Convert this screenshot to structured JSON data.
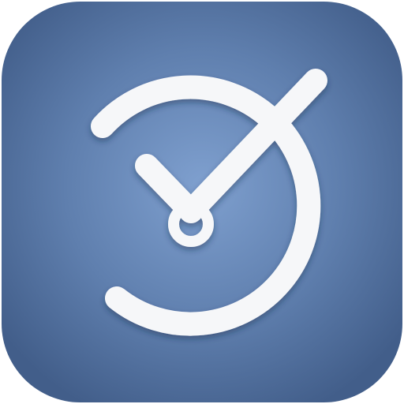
{
  "app_icon": {
    "kind": "clock-checkmark-app-icon",
    "colors": {
      "tile_center": "#7fa0cf",
      "tile_mid": "#5f7fae",
      "tile_edge": "#425e8a",
      "glyph": "#f6f7f9",
      "glyph_shadow": "#1f2f4a"
    },
    "icons": {
      "dial": "clock-dial-arc-icon",
      "check": "checkmark-icon",
      "hub": "clock-hub-icon"
    }
  }
}
